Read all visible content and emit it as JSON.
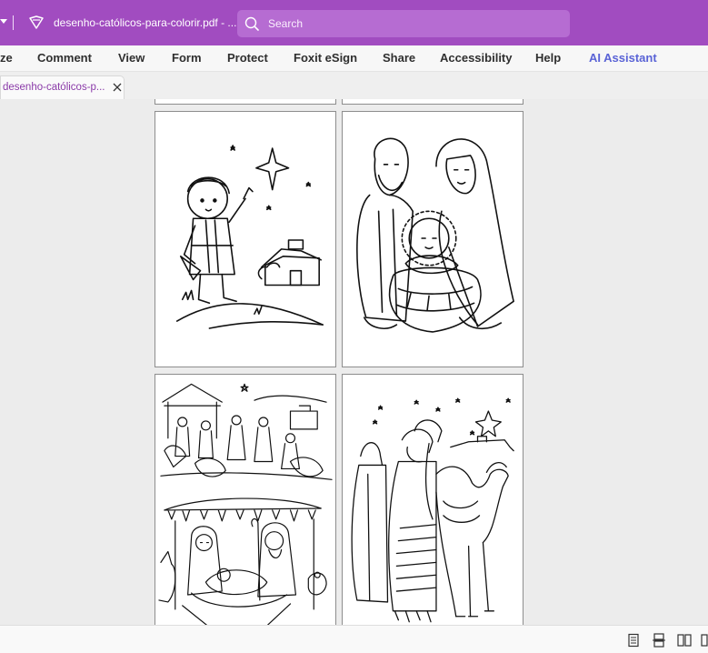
{
  "titlebar": {
    "filename": "desenho-católicos-para-colorir.pdf - ...",
    "search_placeholder": "Search"
  },
  "menu": {
    "items": [
      "ze",
      "Comment",
      "View",
      "Form",
      "Protect",
      "Foxit eSign",
      "Share",
      "Accessibility",
      "Help",
      "AI Assistant"
    ]
  },
  "tabs": [
    {
      "label": "desenho-católicos-p..."
    }
  ],
  "colors": {
    "titlebar": "#a14cc0",
    "search_bg": "#b66cd2",
    "ai_assistant": "#5a63d6",
    "tab_text": "#8a3aa8"
  },
  "pages": [
    {
      "name": "shepherd-boy-star"
    },
    {
      "name": "holy-family-manger"
    },
    {
      "name": "nativity-scenes"
    },
    {
      "name": "three-wise-men-camel"
    }
  ],
  "statusbar": {
    "view_icons": [
      "single-page-icon",
      "continuous-page-icon",
      "two-page-icon",
      "two-page-continuous-icon"
    ]
  }
}
